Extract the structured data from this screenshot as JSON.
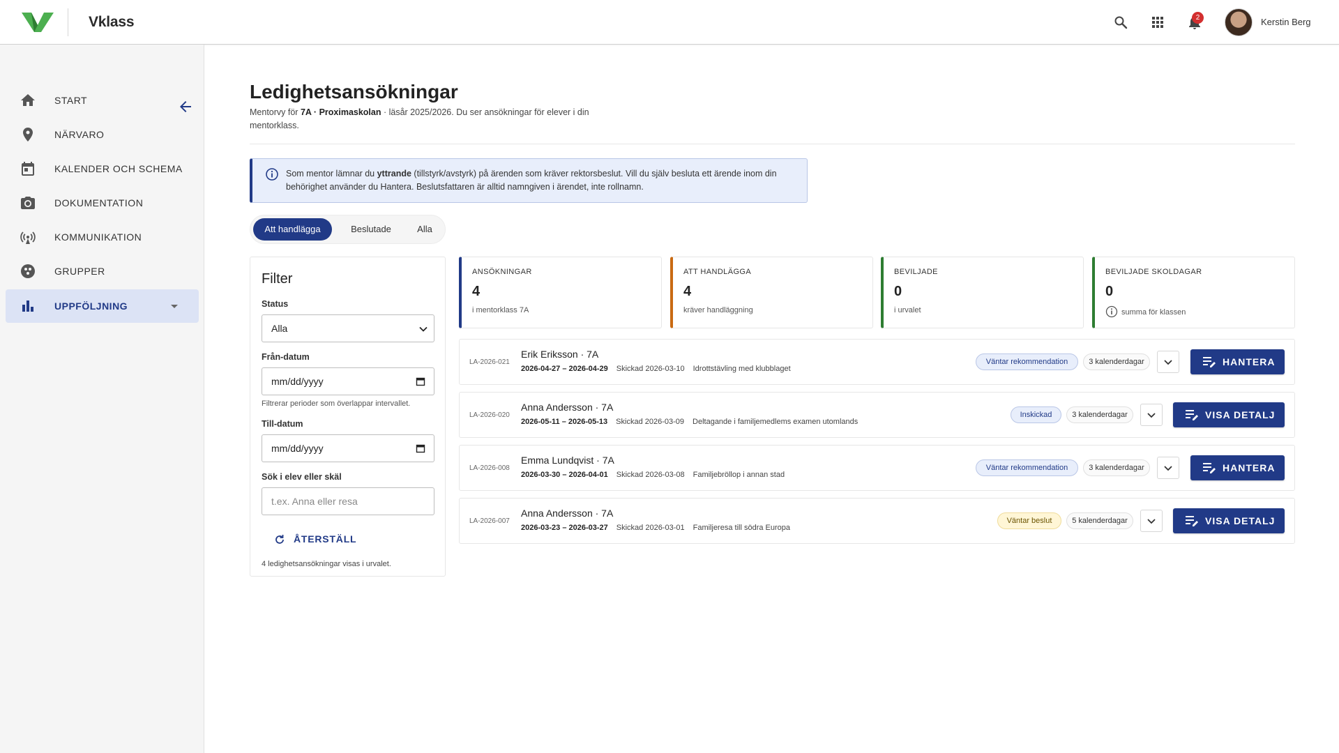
{
  "app": {
    "name": "Vklass"
  },
  "header": {
    "user_name": "Kerstin Berg",
    "notification_count": "2"
  },
  "sidebar": {
    "items": [
      {
        "label": "START",
        "icon": "home-icon"
      },
      {
        "label": "NÄRVARO",
        "icon": "location-pin-icon"
      },
      {
        "label": "KALENDER OCH SCHEMA",
        "icon": "calendar-icon"
      },
      {
        "label": "DOKUMENTATION",
        "icon": "camera-icon"
      },
      {
        "label": "KOMMUNIKATION",
        "icon": "broadcast-icon"
      },
      {
        "label": "GRUPPER",
        "icon": "groups-icon"
      },
      {
        "label": "UPPFÖLJNING",
        "icon": "bar-chart-icon",
        "active": true
      }
    ]
  },
  "page": {
    "title": "Ledighetsansökningar",
    "sub_pre": "Mentorvy för ",
    "sub_class": "7A",
    "sub_sep": " · ",
    "sub_school": "Proximaskolan",
    "sub_post": " · läsår 2025/2026. Du ser ansökningar för elever i din mentorklass."
  },
  "info": {
    "pre": "Som mentor lämnar du ",
    "bold": "yttrande",
    "post": " (tillstyrk/avstyrk) på ärenden som kräver rektorsbeslut. Vill du själv besluta ett ärende inom din behörighet använder du Hantera. Beslutsfattaren är alltid namngiven i ärendet, inte rollnamn."
  },
  "tabs": [
    "Att handlägga",
    "Beslutade",
    "Alla"
  ],
  "filter": {
    "title": "Filter",
    "status_label": "Status",
    "status_value": "Alla",
    "from_label": "Från-datum",
    "from_placeholder": "mm/dd/yyyy",
    "from_hint": "Filtrerar perioder som överlappar intervallet.",
    "to_label": "Till-datum",
    "to_placeholder": "mm/dd/yyyy",
    "search_label": "Sök i elev eller skäl",
    "search_placeholder": "t.ex. Anna eller resa",
    "reset_label": "ÅTERSTÄLL",
    "count_text": "4 ledighetsansökningar visas i urvalet."
  },
  "stats": [
    {
      "label": "ANSÖKNINGAR",
      "value": "4",
      "sub": "i mentorklass 7A",
      "color": "#213a87"
    },
    {
      "label": "ATT HANDLÄGGA",
      "value": "4",
      "sub": "kräver handläggning",
      "color": "#c96a12"
    },
    {
      "label": "BEVILJADE",
      "value": "0",
      "sub": "i urvalet",
      "color": "#2e7d32"
    },
    {
      "label": "BEVILJADE SKOLDAGAR",
      "value": "0",
      "sub": "summa för klassen",
      "color": "#2e7d32"
    }
  ],
  "applications": [
    {
      "id": "LA-2026-021",
      "name": "Erik Eriksson · 7A",
      "dates": "2026-04-27 – 2026-04-29",
      "sent": "Skickad 2026-03-10",
      "reason": "Idrottstävling med klubblaget",
      "status": "Väntar rekommendation",
      "status_style": "blue",
      "days": "3 kalenderdagar",
      "action": "HANTERA"
    },
    {
      "id": "LA-2026-020",
      "name": "Anna Andersson · 7A",
      "dates": "2026-05-11 – 2026-05-13",
      "sent": "Skickad 2026-03-09",
      "reason": "Deltagande i familjemedlems examen utomlands",
      "status": "Inskickad",
      "status_style": "blue",
      "days": "3 kalenderdagar",
      "action": "VISA DETALJ"
    },
    {
      "id": "LA-2026-008",
      "name": "Emma Lundqvist · 7A",
      "dates": "2026-03-30 – 2026-04-01",
      "sent": "Skickad 2026-03-08",
      "reason": "Familjebröllop i annan stad",
      "status": "Väntar rekommendation",
      "status_style": "blue",
      "days": "3 kalenderdagar",
      "action": "HANTERA"
    },
    {
      "id": "LA-2026-007",
      "name": "Anna Andersson · 7A",
      "dates": "2026-03-23 – 2026-03-27",
      "sent": "Skickad 2026-03-01",
      "reason": "Familjeresa till södra Europa",
      "status": "Väntar beslut",
      "status_style": "yellow",
      "days": "5 kalenderdagar",
      "action": "VISA DETALJ"
    }
  ]
}
